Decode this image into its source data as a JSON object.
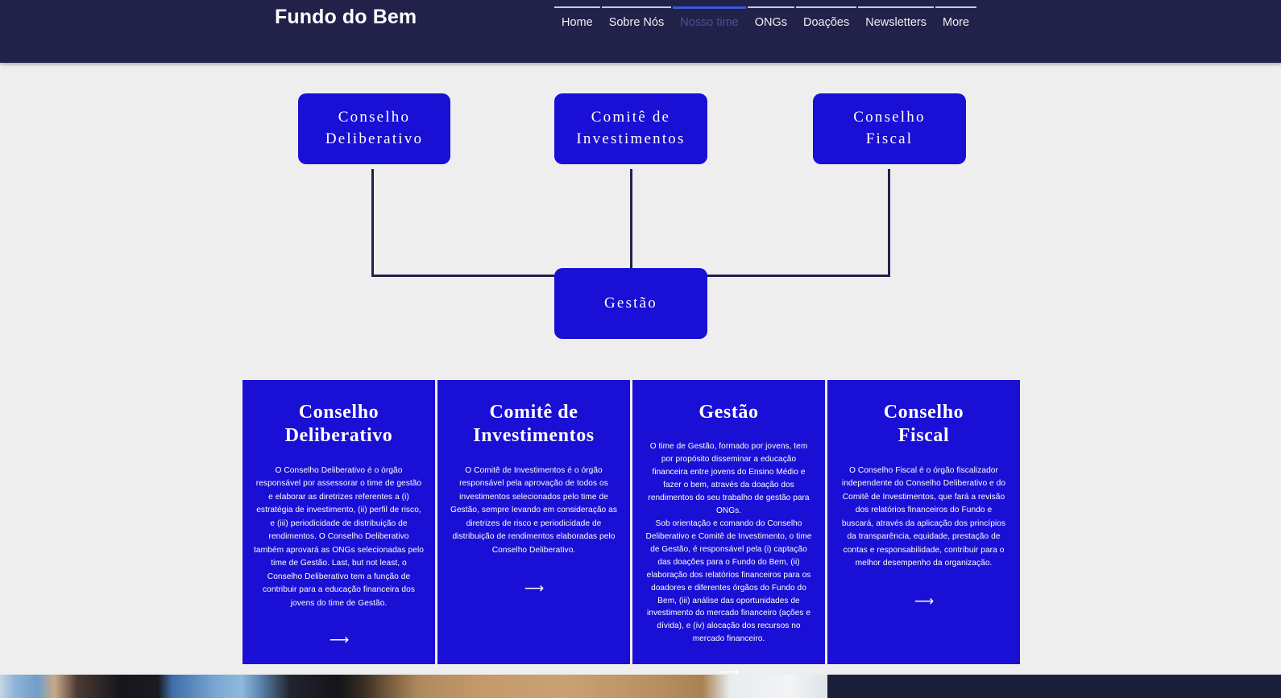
{
  "header": {
    "brand": "Fundo do Bem",
    "nav": [
      {
        "label": "Home",
        "active": false
      },
      {
        "label": "Sobre Nós",
        "active": false
      },
      {
        "label": "Nosso time",
        "active": true
      },
      {
        "label": "ONGs",
        "active": false
      },
      {
        "label": "Doações",
        "active": false
      },
      {
        "label": "Newsletters",
        "active": false
      },
      {
        "label": "More",
        "active": false
      }
    ]
  },
  "org_chart": {
    "top_boxes": [
      {
        "label": "Conselho\nDeliberativo"
      },
      {
        "label": "Comitê de\nInvestimentos"
      },
      {
        "label": "Conselho\nFiscal"
      }
    ],
    "bottom_box": {
      "label": "Gestão"
    }
  },
  "cards": [
    {
      "title": "Conselho\nDeliberativo",
      "body": "O Conselho Deliberativo é o órgão responsável por assessorar o time de gestão e elaborar as diretrizes referentes a (i) estratégia de investimento, (ii) perfil de risco, e (iii) periodicidade de distribuição de rendimentos. O Conselho Deliberativo também aprovará as ONGs selecionadas pelo time de Gestão. Last, but not least, o Conselho Deliberativo tem a função de contribuir para a educação financeira dos jovens do time de Gestão.",
      "arrow": "⟶"
    },
    {
      "title": "Comitê de\nInvestimentos",
      "body": "O Comitê de Investimentos é o órgão responsável pela aprovação de todos os investimentos selecionados pelo time de Gestão, sempre levando em consideração as diretrizes de risco e periodicidade de distribuição de rendimentos elaboradas pelo Conselho Deliberativo.",
      "arrow": "⟶"
    },
    {
      "title": "Gestão",
      "body": "O time de Gestão, formado por jovens, tem por propósito disseminar a educação financeira entre jovens do Ensino Médio e fazer o bem, através da doação dos rendimentos do seu trabalho de gestão para ONGs.\nSob orientação e comando do Conselho Deliberativo e Comitê de Investimento, o time de Gestão, é responsável pela (i) captação das doações para o Fundo do Bem, (ii) elaboração dos relatórios financeiros para os doadores e diferentes órgãos do Fundo do Bem, (iii) análise das oportunidades de investimento do mercado financeiro (ações e dívida), e (iv) alocação dos recursos no mercado financeiro.",
      "arrow": "⟶"
    },
    {
      "title": "Conselho\nFiscal",
      "body": "O Conselho Fiscal é o órgão fiscalizador independente do Conselho Deliberativo e do Comitê de Investimentos, que fará a revisão dos relatórios financeiros do Fundo e buscará, através da aplicação dos princípios da transparência, equidade,  prestação de contas e responsabilidade, contribuir para o melhor desempenho da organização.",
      "arrow": "⟶"
    }
  ],
  "colors": {
    "header_bg": "#21214a",
    "page_bg": "#eeeeee",
    "brand_blue": "#1a0fd4",
    "connector": "#21214a",
    "nav_active_underline": "#3a5bd9",
    "nav_active_text": "#4a5490"
  }
}
